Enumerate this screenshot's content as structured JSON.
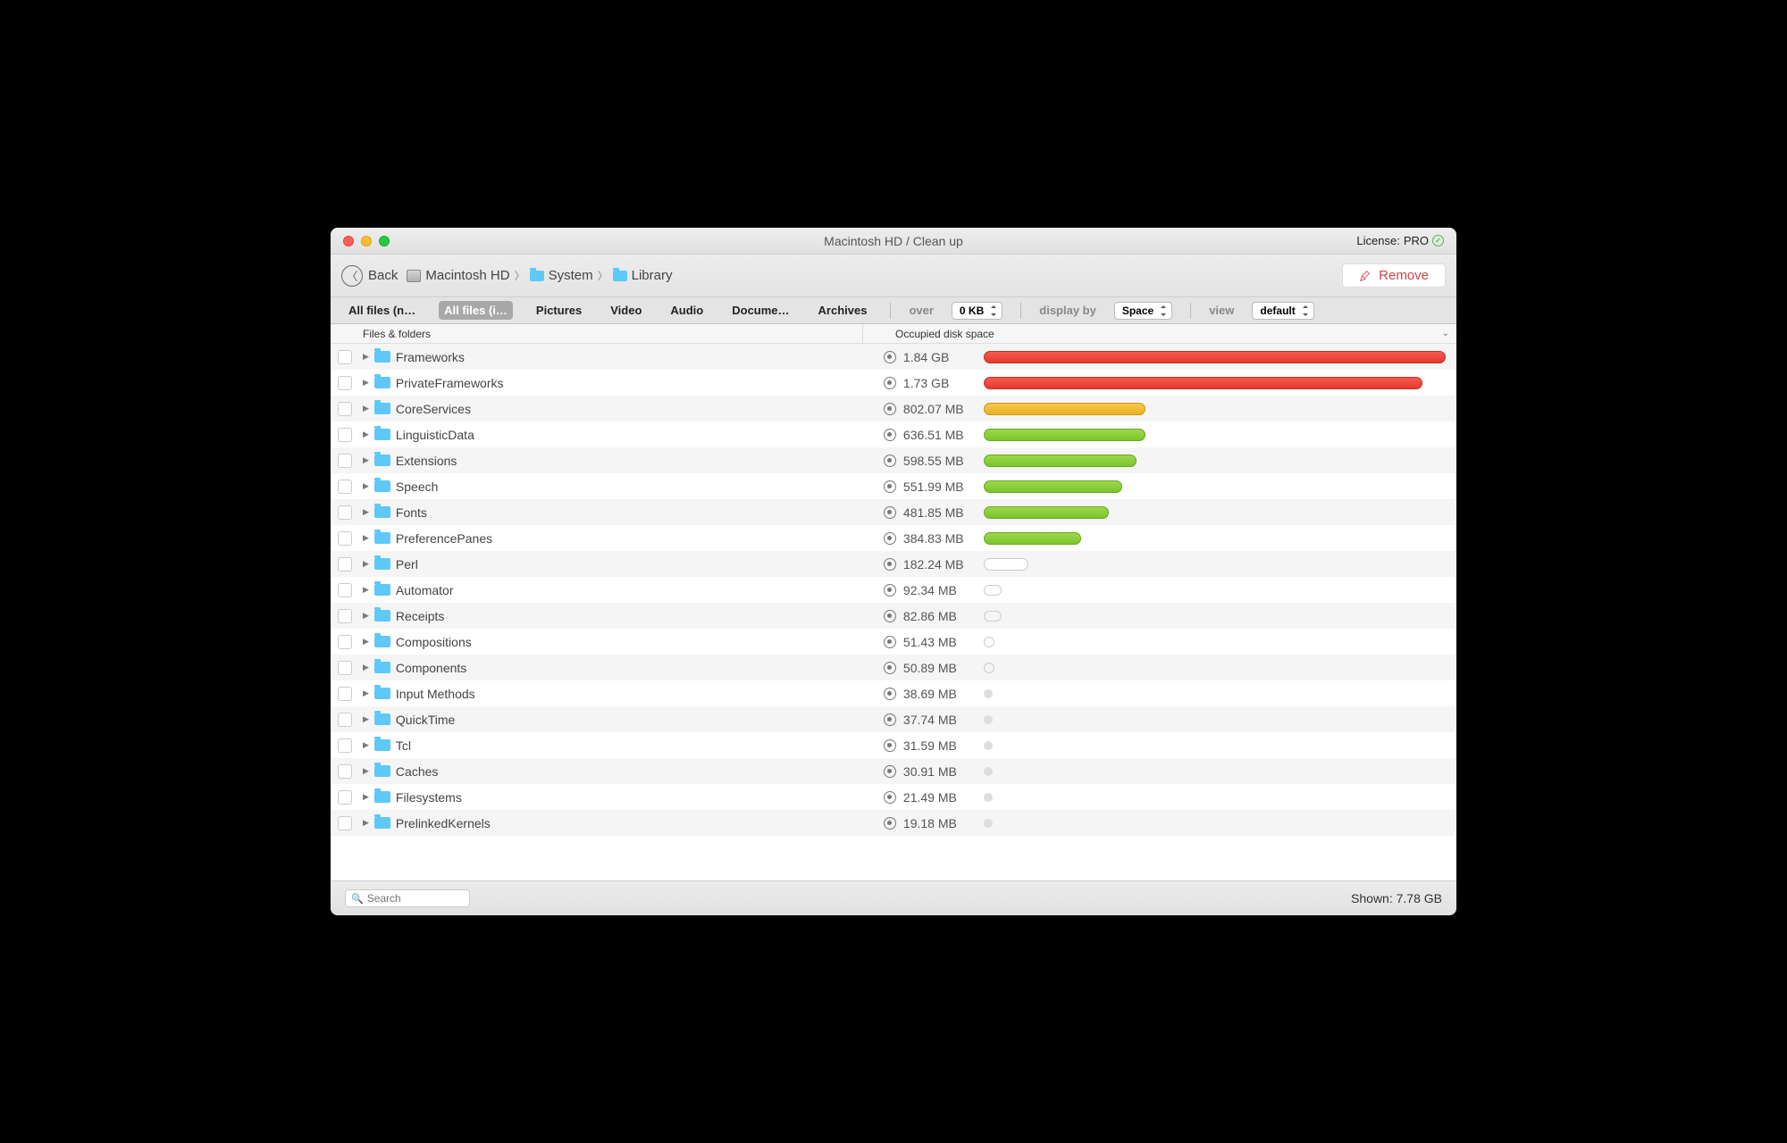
{
  "title": "Macintosh HD / Clean up",
  "license": {
    "label": "License:",
    "tier": "PRO"
  },
  "toolbar": {
    "back": "Back",
    "remove": "Remove"
  },
  "breadcrumbs": [
    {
      "icon": "hd",
      "label": "Macintosh HD"
    },
    {
      "icon": "folder",
      "label": "System"
    },
    {
      "icon": "folder",
      "label": "Library"
    }
  ],
  "tabs": [
    {
      "label": "All files (n…",
      "active": false
    },
    {
      "label": "All files (i…",
      "active": true
    },
    {
      "label": "Pictures",
      "active": false
    },
    {
      "label": "Video",
      "active": false
    },
    {
      "label": "Audio",
      "active": false
    },
    {
      "label": "Docume…",
      "active": false
    },
    {
      "label": "Archives",
      "active": false
    }
  ],
  "options": {
    "over_label": "over",
    "over_value": "0 KB",
    "display_label": "display by",
    "display_value": "Space",
    "view_label": "view",
    "view_value": "default"
  },
  "headers": {
    "files": "Files & folders",
    "space": "Occupied disk space"
  },
  "rows": [
    {
      "name": "Frameworks",
      "size": "1.84 GB",
      "pct": 100,
      "color": "red"
    },
    {
      "name": "PrivateFrameworks",
      "size": "1.73 GB",
      "pct": 95,
      "color": "red"
    },
    {
      "name": "CoreServices",
      "size": "802.07 MB",
      "pct": 35,
      "color": "orange"
    },
    {
      "name": "LinguisticData",
      "size": "636.51 MB",
      "pct": 35,
      "color": "green"
    },
    {
      "name": "Extensions",
      "size": "598.55 MB",
      "pct": 33,
      "color": "green"
    },
    {
      "name": "Speech",
      "size": "551.99 MB",
      "pct": 30,
      "color": "green"
    },
    {
      "name": "Fonts",
      "size": "481.85 MB",
      "pct": 27,
      "color": "green"
    },
    {
      "name": "PreferencePanes",
      "size": "384.83 MB",
      "pct": 21,
      "color": "green"
    },
    {
      "name": "Perl",
      "size": "182.24 MB",
      "pct": 0,
      "color": "outline",
      "shape": "bar",
      "w": 50
    },
    {
      "name": "Automator",
      "size": "92.34 MB",
      "pct": 0,
      "color": "outline",
      "shape": "pill"
    },
    {
      "name": "Receipts",
      "size": "82.86 MB",
      "pct": 0,
      "color": "outline",
      "shape": "pill"
    },
    {
      "name": "Compositions",
      "size": "51.43 MB",
      "pct": 0,
      "color": "outline",
      "shape": "circ"
    },
    {
      "name": "Components",
      "size": "50.89 MB",
      "pct": 0,
      "color": "outline",
      "shape": "circ"
    },
    {
      "name": "Input Methods",
      "size": "38.69 MB",
      "pct": 0,
      "color": "small"
    },
    {
      "name": "QuickTime",
      "size": "37.74 MB",
      "pct": 0,
      "color": "small"
    },
    {
      "name": "Tcl",
      "size": "31.59 MB",
      "pct": 0,
      "color": "small"
    },
    {
      "name": "Caches",
      "size": "30.91 MB",
      "pct": 0,
      "color": "small"
    },
    {
      "name": "Filesystems",
      "size": "21.49 MB",
      "pct": 0,
      "color": "small"
    },
    {
      "name": "PrelinkedKernels",
      "size": "19.18 MB",
      "pct": 0,
      "color": "small"
    }
  ],
  "search_placeholder": "Search",
  "shown": {
    "label": "Shown:",
    "value": "7.78 GB"
  }
}
